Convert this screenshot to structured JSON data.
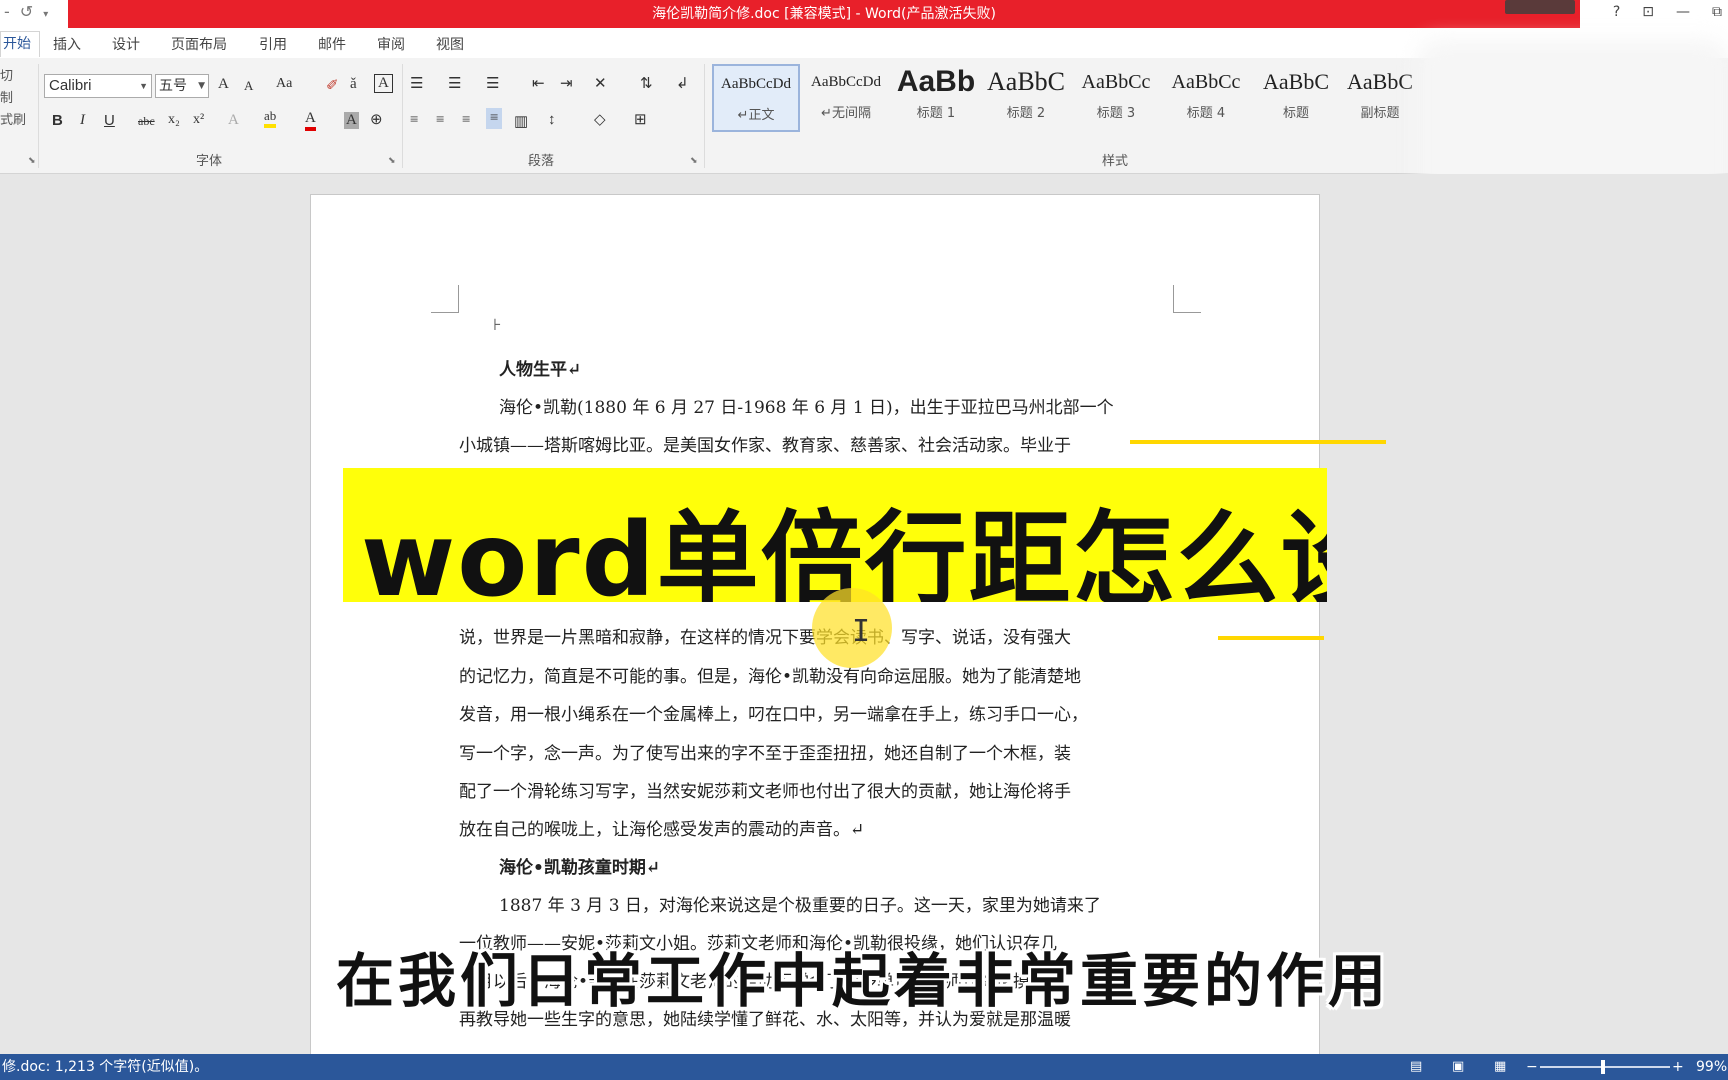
{
  "window": {
    "title": "海伦凯勒简介修.doc [兼容模式] - Word(产品激活失败)",
    "qat_icons": [
      "save-icon",
      "redo-icon",
      "customize-icon"
    ],
    "controls": [
      "?",
      "⊡",
      "—",
      "⧉"
    ]
  },
  "tabs": [
    {
      "label": "开始",
      "active": true
    },
    {
      "label": "插入"
    },
    {
      "label": "设计"
    },
    {
      "label": "页面布局"
    },
    {
      "label": "引用"
    },
    {
      "label": "邮件"
    },
    {
      "label": "审阅"
    },
    {
      "label": "视图"
    }
  ],
  "ribbon": {
    "clipboard": {
      "items": [
        "切",
        "制",
        "式刷"
      ]
    },
    "font": {
      "name": "Calibri",
      "size": "五号",
      "group_label": "字体",
      "grow": "A",
      "shrink": "A",
      "case": "Aa",
      "bold": "B",
      "italic": "I",
      "underline": "U",
      "strike": "abc",
      "sub": "x₂",
      "sup": "x²"
    },
    "paragraph": {
      "group_label": "段落"
    },
    "styles": {
      "group_label": "样式",
      "items": [
        {
          "preview": "AaBbCcDd",
          "label": "↵正文",
          "selected": true
        },
        {
          "preview": "AaBbCcDd",
          "label": "↵无间隔"
        },
        {
          "preview": "AaBb",
          "label": "标题 1"
        },
        {
          "preview": "AaBbC",
          "label": "标题 2"
        },
        {
          "preview": "AaBbCc",
          "label": "标题 3"
        },
        {
          "preview": "AaBbCc",
          "label": "标题 4"
        },
        {
          "preview": "AaBbC",
          "label": "标题"
        },
        {
          "preview": "AaBbC",
          "label": "副标题"
        }
      ]
    }
  },
  "document": {
    "lines": [
      {
        "text": "人物生平↵",
        "bold": true
      },
      {
        "text": "海伦•凯勒(1880 年 6 月 27 日-1968 年 6 月 1 日)，出生于亚拉巴马州北部一个"
      },
      {
        "text": "小城镇——塔斯喀姆比亚。是美国女作家、教育家、慈善家、社会活动家。毕业于"
      },
      {
        "text": "说，世界是一片黑暗和寂静，在这样的情况下要学会读书、写字、说话，没有强大"
      },
      {
        "text": "的记忆力，简直是不可能的事。但是，海伦•凯勒没有向命运屈服。她为了能清楚地"
      },
      {
        "text": "发音，用一根小绳系在一个金属棒上，叼在口中，另一端拿在手上，练习手口一心，"
      },
      {
        "text": "写一个字，念一声。为了使写出来的字不至于歪歪扭扭，她还自制了一个木框，装"
      },
      {
        "text": "配了一个滑轮练习写字，当然安妮莎莉文老师也付出了很大的贡献，她让海伦将手"
      },
      {
        "text": "放在自己的喉咙上，让海伦感受发声的震动的声音。↵"
      },
      {
        "text": "海伦•凯勒孩童时期↵",
        "bold": true
      },
      {
        "text": "1887 年 3 月 3 日，对海伦来说这是个极重要的日子。这一天，家里为她请来了"
      },
      {
        "text": "一位教师——安妮•莎莉文小姐。莎莉文老师和海伦•凯勒很投缘，她们认识存几"
      },
      {
        "text": "个月以后，海伦•凯勒在莎莉文老师的帮助下学会了很多单词，老师让海伦摸水，"
      },
      {
        "text": "再教导她一些生字的意思，她陆续学懂了鲜花、水、太阳等，并认为爱就是那温暖"
      }
    ]
  },
  "overlay": {
    "banner": "word单倍行距怎么设置",
    "subtitle": "在我们日常工作中起着非常重要的作用"
  },
  "status": {
    "text": "修.doc: 1,213 个字符(近似值)。",
    "zoom": "99%",
    "zoom_level": 0.5
  },
  "colors": {
    "title_red": "#e8202a",
    "accent_blue": "#2b579a",
    "banner_yellow": "#ffff0a"
  }
}
